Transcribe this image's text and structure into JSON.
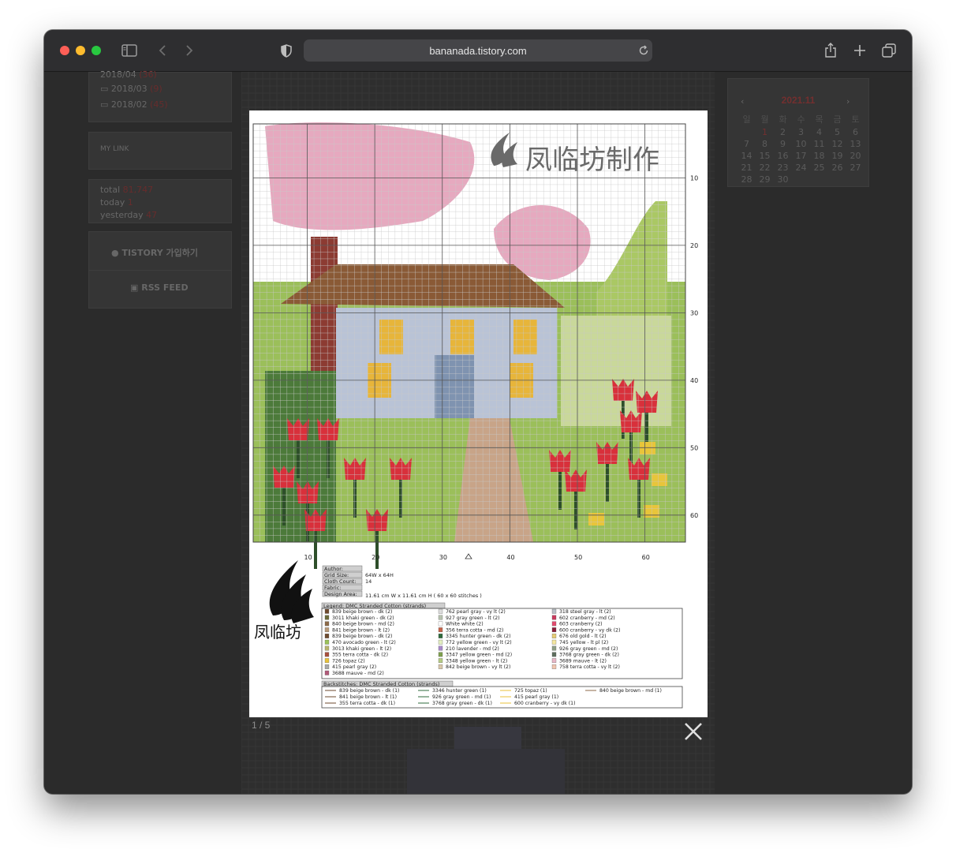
{
  "browser": {
    "url": "bananada.tistory.com",
    "icons": [
      "sidebar-icon",
      "back-icon",
      "forward-icon",
      "shield-icon",
      "reload-icon",
      "share-icon",
      "new-tab-icon",
      "tabs-icon"
    ]
  },
  "sidebar": {
    "archives": [
      {
        "month": "2018/04",
        "count": "(36)"
      },
      {
        "month": "2018/03",
        "count": "(9)"
      },
      {
        "month": "2018/02",
        "count": "(45)"
      }
    ],
    "my_link": "MY LINK",
    "stats": {
      "total_label": "total",
      "total": "81,747",
      "today_label": "today",
      "today": "1",
      "yesterday_label": "yesterday",
      "yesterday": "47"
    },
    "tistory_label": "TISTORY 가입하기",
    "rss_label": "RSS FEED"
  },
  "calendar": {
    "title": "2021.11",
    "prev": "‹",
    "next": "›",
    "weekdays": [
      "일",
      "월",
      "화",
      "수",
      "목",
      "금",
      "토"
    ],
    "weeks": [
      [
        "",
        "1",
        "2",
        "3",
        "4",
        "5",
        "6"
      ],
      [
        "7",
        "8",
        "9",
        "10",
        "11",
        "12",
        "13"
      ],
      [
        "14",
        "15",
        "16",
        "17",
        "18",
        "19",
        "20"
      ],
      [
        "21",
        "22",
        "23",
        "24",
        "25",
        "26",
        "27"
      ],
      [
        "28",
        "29",
        "30",
        "",
        "",
        "",
        ""
      ]
    ]
  },
  "lightbox": {
    "counter": "1 / 5",
    "close_label": "×"
  },
  "pattern": {
    "watermark": "凤临坊制作",
    "logo_text": "凤临坊",
    "row_numbers": [
      "10",
      "20",
      "30",
      "40",
      "50",
      "60"
    ],
    "col_numbers": [
      "10",
      "20",
      "30",
      "40",
      "50",
      "60"
    ],
    "info": {
      "author_label": "Author:",
      "grid_size_label": "Grid Size:",
      "grid_size": "64W x 64H",
      "cloth_count_label": "Cloth Count:",
      "cloth_count": "14",
      "fabric_label": "Fabric:",
      "design_area_label": "Design Area:",
      "design_area": "11.61 cm W  x  11.61 cm H   ( 60 x 60 stitches )"
    },
    "legend_title": "Legend: DMC Stranded Cotton (strands)",
    "legend_col1": [
      "839  beige brown - dk (2)",
      "3011  khaki green - dk (2)",
      "840  beige brown - md (2)",
      "841  beige brown - lt (2)",
      "839  beige brown - dk (2)",
      "470  avocado green - lt (2)",
      "3013  khaki green - lt (2)",
      "355  terra cotta - dk (2)",
      "726  topaz (2)",
      "415  pearl gray (2)",
      "3688  mauve - md (2)"
    ],
    "legend_col2": [
      "762  pearl gray - vy lt (2)",
      "927  gray green - lt (2)",
      "White  white (2)",
      "356  terra cotta - md (2)",
      "3345  hunter green - dk (2)",
      "772  yellow green - vy lt (2)",
      "210  lavender - md (2)",
      "3347  yellow green - md (2)",
      "3348  yellow green - lt (2)",
      "842  beige brown - vy lt (2)"
    ],
    "legend_col3": [
      "318  steel gray - lt (2)",
      "602  cranberry - md (2)",
      "603  cranberry (2)",
      "600  cranberry - vy dk (2)",
      "676  old gold - lt (2)",
      "745  yellow - lt pl (2)",
      "926  gray green - md (2)",
      "3768  gray green - dk (2)",
      "3689  mauve - lt (2)",
      "758  terra cotta - vy lt (2)"
    ],
    "backstitch_title": "Backstitches: DMC Stranded Cotton (strands)",
    "backstitch_col1": [
      "839  beige brown - dk (1)",
      "841  beige brown - lt (1)",
      "355  terra cotta - dk (1)"
    ],
    "backstitch_col2": [
      "3346  hunter green (1)",
      "926  gray green - md (1)",
      "3768  gray green - dk (1)"
    ],
    "backstitch_col3": [
      "725  topaz (1)",
      "415  pearl gray (1)",
      "600  cranberry - vy dk (1)"
    ],
    "backstitch_col4": [
      "840  beige brown - md (1)"
    ]
  },
  "colors": {
    "blossom": "#e6a9bf",
    "roof": "#8a5a36",
    "wall": "#b9c3d6",
    "window": "#e7b53a",
    "leaf_green": "#9bbf5a",
    "dark_green": "#2e4f2a",
    "tulip": "#d8303b",
    "path": "#c8a488",
    "chimney": "#8c3b32",
    "sky": "#ffffff"
  }
}
